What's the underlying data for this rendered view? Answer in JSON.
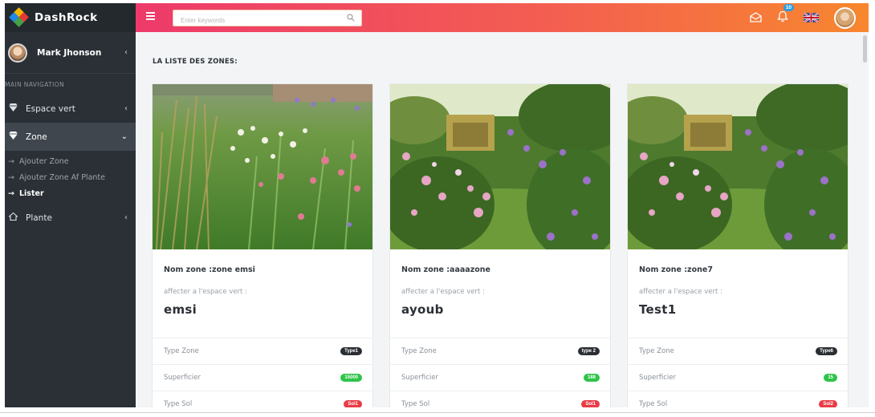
{
  "brand": {
    "name": "DashRock"
  },
  "user": {
    "name": "Mark Jhonson"
  },
  "sidebar": {
    "section": "MAIN NAVIGATION",
    "items": [
      {
        "label": "Espace vert",
        "icon": "gem-icon",
        "chevron": "‹"
      },
      {
        "label": "Zone",
        "icon": "gem-icon",
        "chevron": "⌄"
      },
      {
        "label": "Plante",
        "icon": "home-icon",
        "chevron": "‹"
      }
    ],
    "sub_items": [
      {
        "label": "Ajouter Zone"
      },
      {
        "label": "Ajouter Zone Af Plante"
      },
      {
        "label": "Lister"
      }
    ]
  },
  "topbar": {
    "search_placeholder": "Enter keywords",
    "notification_count": "10"
  },
  "page": {
    "title": "LA LISTE DES ZONES:"
  },
  "cards": [
    {
      "nom": "Nom zone :zone emsi",
      "affecter": "affecter a l'espace vert :",
      "espace": "emsi",
      "rows": [
        {
          "label": "Type Zone",
          "value": "Type1",
          "color": "dark"
        },
        {
          "label": "Superficier",
          "value": "15000",
          "color": "green"
        },
        {
          "label": "Type Sol",
          "value": "Sol1",
          "color": "red"
        }
      ]
    },
    {
      "nom": "Nom zone :aaaazone",
      "affecter": "affecter a l'espace vert :",
      "espace": "ayoub",
      "rows": [
        {
          "label": "Type Zone",
          "value": "type 2",
          "color": "dark"
        },
        {
          "label": "Superficier",
          "value": "188",
          "color": "green"
        },
        {
          "label": "Type Sol",
          "value": "Sol1",
          "color": "red"
        }
      ]
    },
    {
      "nom": "Nom zone :zone7",
      "affecter": "affecter a l'espace vert :",
      "espace": "Test1",
      "rows": [
        {
          "label": "Type Zone",
          "value": "Type6",
          "color": "dark"
        },
        {
          "label": "Superficier",
          "value": "15",
          "color": "green"
        },
        {
          "label": "Type Sol",
          "value": "Sol2",
          "color": "red"
        }
      ]
    }
  ],
  "colors": {
    "sidebar_bg": "#2b3036",
    "topbar_gradient_start": "#ee3a6b",
    "topbar_gradient_end": "#f7872e",
    "badge_dark": "#2a2e33",
    "badge_green": "#2ec44a",
    "badge_red": "#ea3b47",
    "notification_badge": "#2d9ee0"
  }
}
